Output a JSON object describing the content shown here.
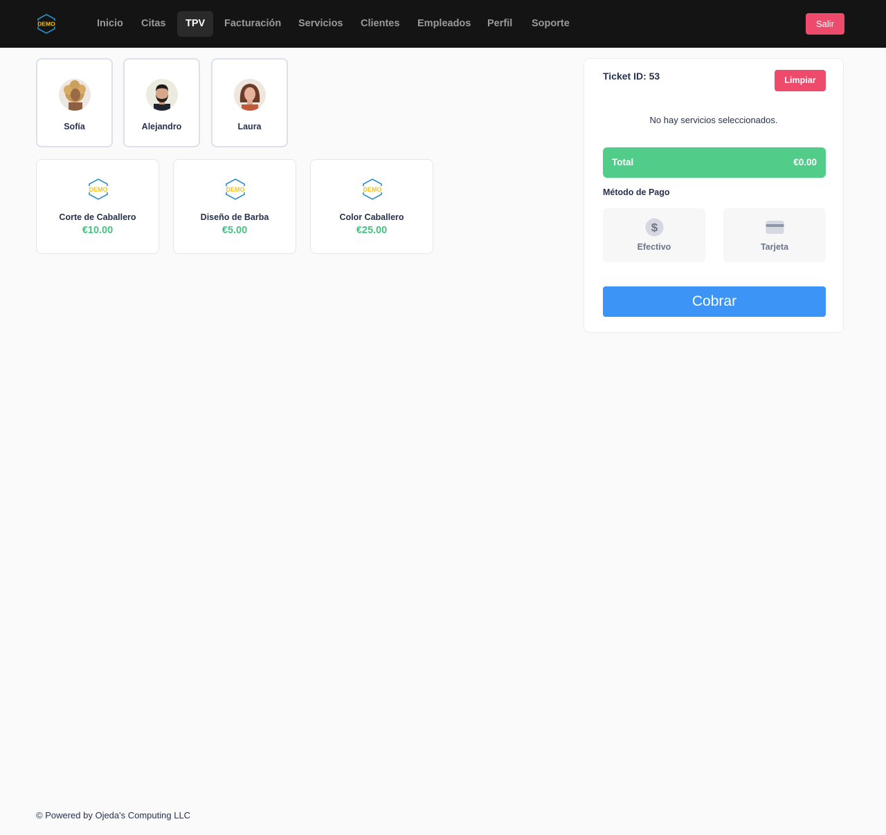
{
  "nav": {
    "logo_text": "DEMO",
    "items": [
      {
        "label": "Inicio"
      },
      {
        "label": "Citas"
      },
      {
        "label": "TPV",
        "active": true
      },
      {
        "label": "Facturación"
      },
      {
        "label": "Servicios"
      },
      {
        "label": "Clientes"
      },
      {
        "label": "Empleados"
      },
      {
        "label": "Perfil"
      },
      {
        "label": "Soporte"
      }
    ],
    "logout_label": "Salir"
  },
  "employees": [
    {
      "name": "Sofía"
    },
    {
      "name": "Alejandro"
    },
    {
      "name": "Laura"
    }
  ],
  "services": [
    {
      "name": "Corte de Caballero",
      "price": "€10.00",
      "logo_text": "DEMO"
    },
    {
      "name": "Diseño de Barba",
      "price": "€5.00",
      "logo_text": "DEMO"
    },
    {
      "name": "Color Caballero",
      "price": "€25.00",
      "logo_text": "DEMO"
    }
  ],
  "ticket": {
    "id_label": "Ticket ID: 53",
    "clear_label": "Limpiar",
    "empty_message": "No hay servicios seleccionados.",
    "total_label": "Total",
    "total_value": "€0.00",
    "payment_title": "Método de Pago",
    "payment_options": [
      {
        "label": "Efectivo",
        "icon": "dollar-icon"
      },
      {
        "label": "Tarjeta",
        "icon": "credit-card-icon"
      }
    ],
    "charge_label": "Cobrar"
  },
  "footer": {
    "text": "© Powered by Ojeda's Computing LLC"
  },
  "colors": {
    "topbar": "#141414",
    "danger": "#ee4a6c",
    "success": "#52cc89",
    "price": "#45c280",
    "primary": "#3b94f6"
  }
}
